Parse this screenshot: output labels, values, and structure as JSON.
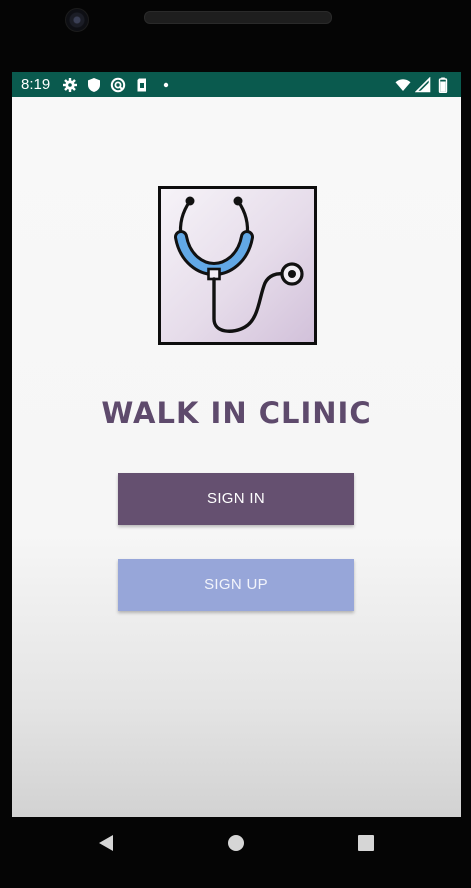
{
  "status_bar": {
    "time": "8:19",
    "left_icons": [
      "gear-icon",
      "shield-icon",
      "vpn-key-icon",
      "sim-card-icon",
      "notification-dot-icon"
    ],
    "right_icons": [
      "wifi-icon",
      "cell-signal-icon",
      "battery-icon"
    ],
    "background_color": "#0a5a4e"
  },
  "app": {
    "title": "WALK IN CLINIC",
    "logo_icon": "stethoscope-icon",
    "buttons": {
      "sign_in": "SIGN IN",
      "sign_up": "SIGN UP"
    },
    "colors": {
      "title": "#5e4a6c",
      "sign_in_bg": "#655070",
      "sign_up_bg": "#97a6d9",
      "stethoscope_tube": "#62a8e6"
    }
  },
  "nav_bar": {
    "icons": [
      "back-icon",
      "home-icon",
      "recents-icon"
    ]
  }
}
